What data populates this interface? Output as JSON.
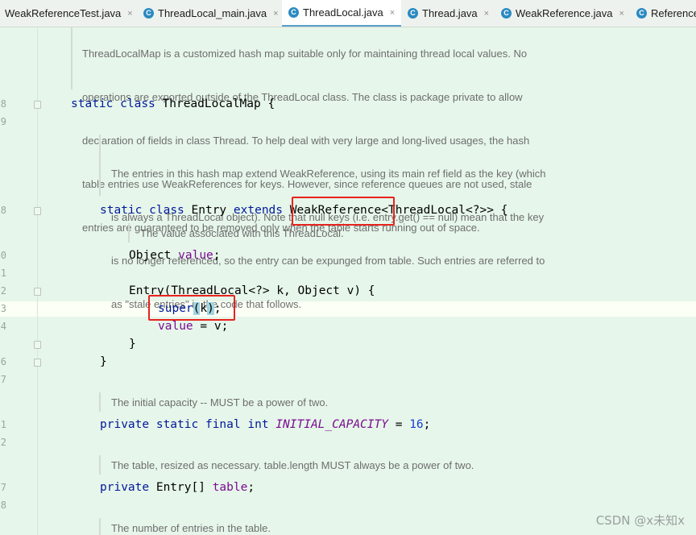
{
  "tabs": [
    {
      "label": "WeakReferenceTest.java",
      "active": false,
      "icon": "java-class-icon"
    },
    {
      "label": "ThreadLocal_main.java",
      "active": false,
      "icon": "java-class-icon"
    },
    {
      "label": "ThreadLocal.java",
      "active": true,
      "icon": "java-class-icon"
    },
    {
      "label": "Thread.java",
      "active": false,
      "icon": "java-class-icon"
    },
    {
      "label": "WeakReference.java",
      "active": false,
      "icon": "java-class-icon"
    },
    {
      "label": "Reference",
      "active": false,
      "icon": "java-class-icon"
    }
  ],
  "close_glyph": "×",
  "line_numbers": [
    "8",
    "9",
    "8",
    "0",
    "1",
    "2",
    "3",
    "4",
    "6",
    "7",
    "1",
    "2",
    "7",
    "8"
  ],
  "doc_top": [
    "ThreadLocalMap is a customized hash map suitable only for maintaining thread local values. No",
    "operations are exported outside of the ThreadLocal class. The class is package private to allow",
    "declaration of fields in class Thread. To help deal with very large and long-lived usages, the hash",
    "table entries use WeakReferences for keys. However, since reference queues are not used, stale",
    "entries are guaranteed to be removed only when the table starts running out of space."
  ],
  "doc_entry": [
    "The entries in this hash map extend WeakReference, using its main ref field as the key (which",
    "is always a ThreadLocal object). Note that null keys (i.e. entry.get() == null) mean that the key",
    "is no longer referenced, so the entry can be expunged from table. Such entries are referred to",
    "as \"stale entries\" in the code that follows."
  ],
  "doc_value": "The value associated with this ThreadLocal.",
  "doc_capacity": "The initial capacity -- MUST be a power of two.",
  "doc_table": "The table, resized as necessary. table.length MUST always be a power of two.",
  "doc_size": "The number of entries in the table.",
  "code": {
    "l_class": {
      "k1": "static",
      "k2": "class",
      "name": "ThreadLocalMap",
      "tail": " {"
    },
    "l_entry": {
      "k1": "static",
      "k2": "class",
      "name": "Entry",
      "k3": "extends",
      "sup": "WeakReference",
      "tail": "<ThreadLocal<?>> {"
    },
    "l_value": {
      "type": "Object",
      "field": "value",
      "tail": ";"
    },
    "l_ctor": {
      "text": "Entry(ThreadLocal<?> k, Object v) {"
    },
    "l_super": {
      "kw": "super",
      "open": "(",
      "arg": "k",
      "close": ")",
      "tail": ";"
    },
    "l_assign": {
      "field": "value",
      "tail": " = v;"
    },
    "l_close1": "}",
    "l_close2": "}",
    "l_cap": {
      "k1": "private",
      "k2": "static",
      "k3": "final",
      "k4": "int",
      "name": "INITIAL_CAPACITY",
      "eq": " = ",
      "num": "16",
      "tail": ";"
    },
    "l_table": {
      "k1": "private",
      "type": "Entry[]",
      "field": "table",
      "tail": ";"
    }
  },
  "watermark": "CSDN @x未知x"
}
